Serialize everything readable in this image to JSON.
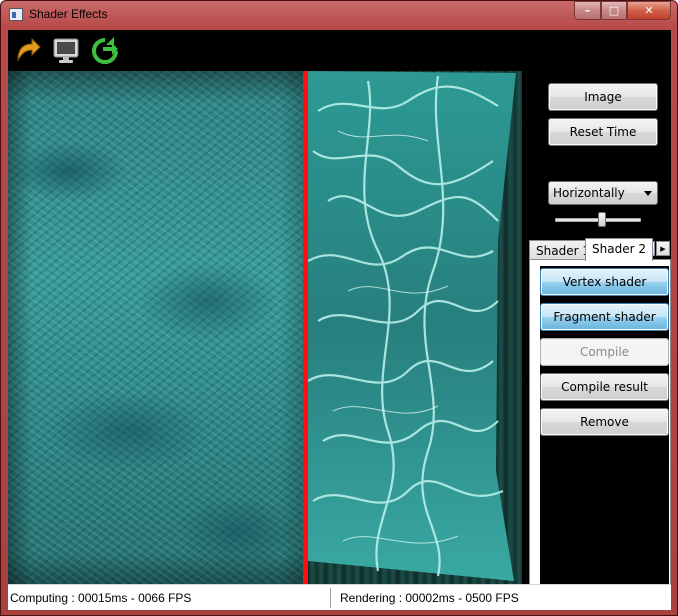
{
  "window": {
    "title": "Shader Effects",
    "buttons": {
      "minimize": "–",
      "maximize": "□",
      "close": "✕"
    }
  },
  "toolbar": {
    "icons": [
      "rotate-arrow-icon",
      "monitor-icon",
      "refresh-arrow-icon"
    ]
  },
  "side": {
    "image_button": "Image",
    "reset_time_button": "Reset Time",
    "direction_select": {
      "value": "Horizontally"
    },
    "slider_level": 0.55,
    "tabs": [
      "Shader 1",
      "Shader 2"
    ],
    "active_tab": "Shader 2",
    "tab_nav": {
      "prev": "◀",
      "next": "▶"
    },
    "panel_buttons": {
      "vertex_shader": "Vertex shader",
      "fragment_shader": "Fragment shader",
      "compile": "Compile",
      "compile_result": "Compile result",
      "remove": "Remove"
    }
  },
  "status": {
    "computing": "Computing : 00015ms - 0066 FPS",
    "rendering": "Rendering : 00002ms - 0500 FPS"
  },
  "colors": {
    "title_bar": "#b84a4a",
    "divider": "#ff0f0f",
    "water": "#3a9b98",
    "active_button": "#68b3db"
  }
}
